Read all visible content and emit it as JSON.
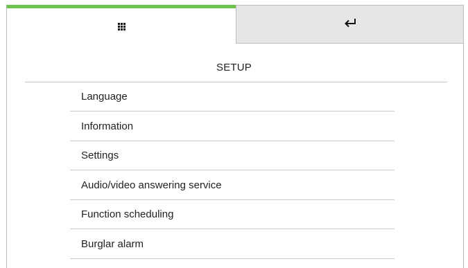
{
  "header": {
    "tabs": [
      {
        "name": "home",
        "icon": "grid-icon"
      },
      {
        "name": "back",
        "icon": "return-arrow-icon"
      }
    ],
    "accent_color": "#6cc24a"
  },
  "page": {
    "title": "SETUP"
  },
  "menu": {
    "items": [
      {
        "label": "Language"
      },
      {
        "label": "Information"
      },
      {
        "label": "Settings"
      },
      {
        "label": "Audio/video answering service"
      },
      {
        "label": "Function scheduling"
      },
      {
        "label": "Burglar alarm"
      }
    ]
  }
}
